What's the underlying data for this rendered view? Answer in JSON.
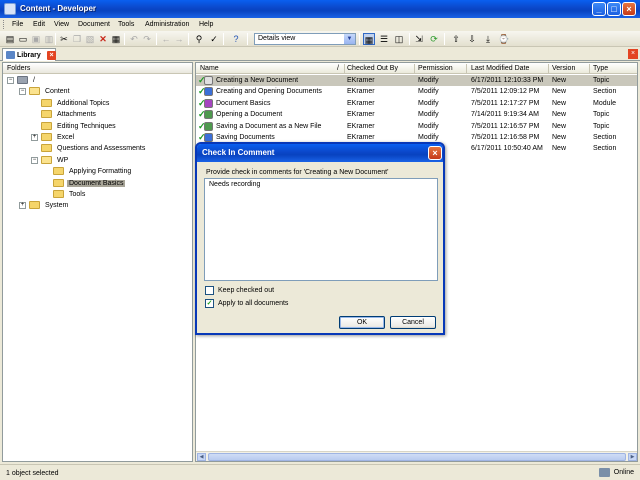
{
  "window": {
    "title": "Content - Developer"
  },
  "menu": [
    "File",
    "Edit",
    "View",
    "Document",
    "Tools",
    "Administration",
    "Help"
  ],
  "toolbar": {
    "view_mode": "Details view"
  },
  "tab": {
    "label": "Library"
  },
  "folders": {
    "header": "Folders",
    "nodes": [
      {
        "label": "/",
        "level": 0,
        "expander": "−",
        "icon": "root"
      },
      {
        "label": "Content",
        "level": 1,
        "expander": "−",
        "icon": "open"
      },
      {
        "label": "Additional Topics",
        "level": 2,
        "expander": "",
        "icon": "closed"
      },
      {
        "label": "Attachments",
        "level": 2,
        "expander": "",
        "icon": "closed"
      },
      {
        "label": "Editing Techniques",
        "level": 2,
        "expander": "",
        "icon": "closed"
      },
      {
        "label": "Excel",
        "level": 2,
        "expander": "+",
        "icon": "closed"
      },
      {
        "label": "Questions and Assessments",
        "level": 2,
        "expander": "",
        "icon": "closed"
      },
      {
        "label": "WP",
        "level": 2,
        "expander": "−",
        "icon": "open"
      },
      {
        "label": "Applying Formatting",
        "level": 3,
        "expander": "",
        "icon": "closed"
      },
      {
        "label": "Document Basics",
        "level": 3,
        "expander": "",
        "icon": "closed",
        "selected": true
      },
      {
        "label": "Tools",
        "level": 3,
        "expander": "",
        "icon": "closed"
      },
      {
        "label": "System",
        "level": 1,
        "expander": "+",
        "icon": "closed"
      }
    ]
  },
  "documents": {
    "columns": [
      "Name",
      "/",
      "Checked Out By",
      "Permission",
      "Last Modified Date",
      "Version",
      "Type"
    ],
    "rows": [
      {
        "name": "Creating a New Document",
        "checked_out_by": "EKramer",
        "permission": "Modify",
        "modified": "6/17/2011 12:10:33 PM",
        "version": "New",
        "type": "Topic",
        "icon": "topic-icon",
        "color": "#e0e0e0",
        "selected": true
      },
      {
        "name": "Creating and Opening Documents",
        "checked_out_by": "EKramer",
        "permission": "Modify",
        "modified": "7/5/2011 12:09:12 PM",
        "version": "New",
        "type": "Section",
        "icon": "section-icon",
        "color": "#3b6fd8"
      },
      {
        "name": "Document Basics",
        "checked_out_by": "EKramer",
        "permission": "Modify",
        "modified": "7/5/2011 12:17:27 PM",
        "version": "New",
        "type": "Module",
        "icon": "module-icon",
        "color": "#a545c0"
      },
      {
        "name": "Opening a Document",
        "checked_out_by": "EKramer",
        "permission": "Modify",
        "modified": "7/14/2011 9:19:34 AM",
        "version": "New",
        "type": "Topic",
        "icon": "topic-icon",
        "color": "#4f9a4f"
      },
      {
        "name": "Saving a Document as a New File",
        "checked_out_by": "EKramer",
        "permission": "Modify",
        "modified": "7/5/2011 12:16:57 PM",
        "version": "New",
        "type": "Topic",
        "icon": "topic-icon",
        "color": "#4f9a4f"
      },
      {
        "name": "Saving Documents",
        "checked_out_by": "EKramer",
        "permission": "Modify",
        "modified": "7/5/2011 12:16:58 PM",
        "version": "New",
        "type": "Section",
        "icon": "section-icon",
        "color": "#3b6fd8"
      },
      {
        "name": "",
        "checked_out_by": "",
        "permission": "",
        "modified": "6/17/2011 10:50:40 AM",
        "version": "New",
        "type": "Section",
        "icon": "",
        "color": ""
      }
    ]
  },
  "status": {
    "left": "1 object selected",
    "right": "Online"
  },
  "dialog": {
    "title": "Check In Comment",
    "prompt": "Provide check in comments for 'Creating a New Document'",
    "comment": "Needs recording",
    "keep_checked_out": {
      "label": "Keep checked out",
      "checked": false
    },
    "apply_all": {
      "label": "Apply to all documents",
      "checked": true
    },
    "ok": "OK",
    "cancel": "Cancel"
  }
}
